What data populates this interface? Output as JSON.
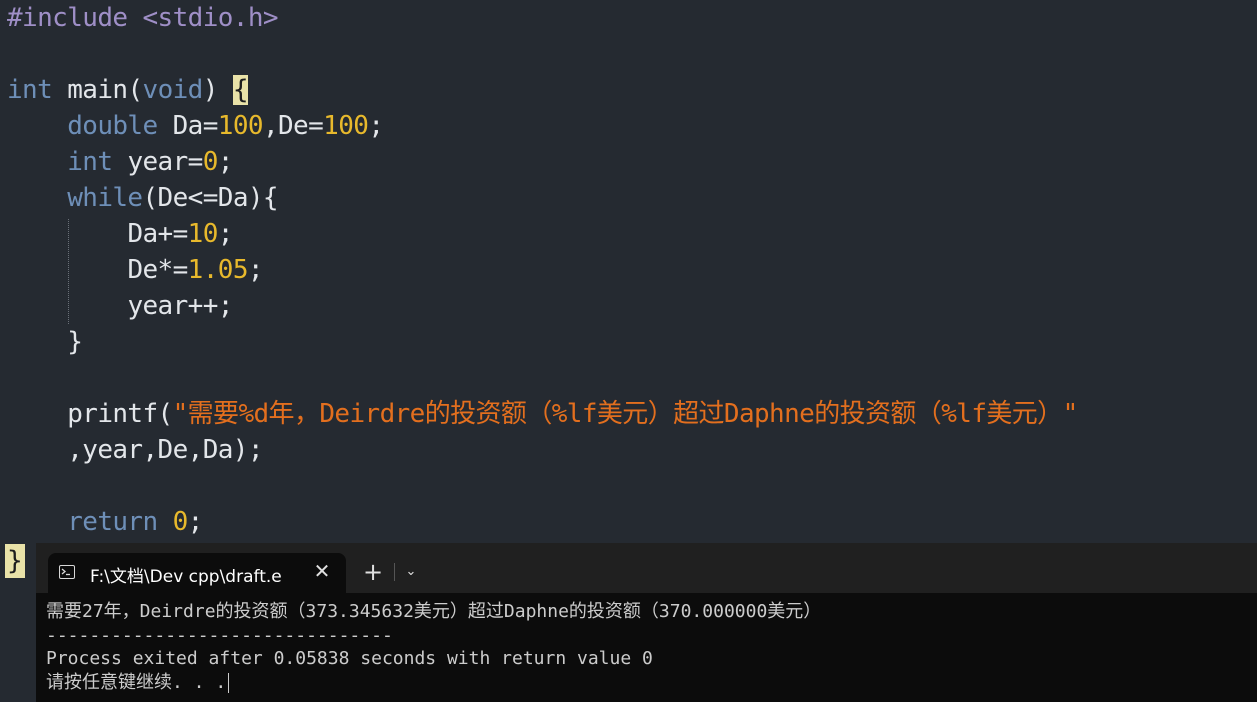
{
  "editor": {
    "lines": [
      [
        {
          "t": "#include <stdio.h>",
          "c": "pre"
        }
      ],
      [],
      [
        {
          "t": "int",
          "c": "kw"
        },
        {
          "t": " main",
          "c": "id"
        },
        {
          "t": "(",
          "c": "op"
        },
        {
          "t": "void",
          "c": "kw"
        },
        {
          "t": ") ",
          "c": "op"
        },
        {
          "t": "{",
          "c": "brace-hl"
        }
      ],
      [
        {
          "t": "    "
        },
        {
          "t": "double",
          "c": "kw"
        },
        {
          "t": " Da=",
          "c": "id"
        },
        {
          "t": "100",
          "c": "num"
        },
        {
          "t": ",De=",
          "c": "id"
        },
        {
          "t": "100",
          "c": "num"
        },
        {
          "t": ";",
          "c": "op"
        }
      ],
      [
        {
          "t": "    "
        },
        {
          "t": "int",
          "c": "kw"
        },
        {
          "t": " year=",
          "c": "id"
        },
        {
          "t": "0",
          "c": "num"
        },
        {
          "t": ";",
          "c": "op"
        }
      ],
      [
        {
          "t": "    "
        },
        {
          "t": "while",
          "c": "kw"
        },
        {
          "t": "(De<=Da){",
          "c": "id"
        }
      ],
      [
        {
          "t": "        "
        },
        {
          "t": "Da+=",
          "c": "id"
        },
        {
          "t": "10",
          "c": "num"
        },
        {
          "t": ";",
          "c": "op"
        }
      ],
      [
        {
          "t": "        "
        },
        {
          "t": "De*=",
          "c": "id"
        },
        {
          "t": "1.05",
          "c": "num"
        },
        {
          "t": ";",
          "c": "op"
        }
      ],
      [
        {
          "t": "        "
        },
        {
          "t": "year++;",
          "c": "id"
        }
      ],
      [
        {
          "t": "    "
        },
        {
          "t": "}",
          "c": "op"
        }
      ],
      [],
      [
        {
          "t": "    "
        },
        {
          "t": "printf(",
          "c": "id"
        },
        {
          "t": "\"需要%d年，Deirdre的投资额（%lf美元）超过Daphne的投资额（%lf美元）\"",
          "c": "str"
        }
      ],
      [
        {
          "t": "    "
        },
        {
          "t": ",year,De,Da);",
          "c": "id"
        }
      ],
      [],
      [
        {
          "t": "    "
        },
        {
          "t": "return",
          "c": "kw"
        },
        {
          "t": " ",
          "c": "id"
        },
        {
          "t": "0",
          "c": "num"
        },
        {
          "t": ";",
          "c": "op"
        }
      ]
    ],
    "closing_brace": "}"
  },
  "terminal": {
    "tab_title": "F:\\文档\\Dev cpp\\draft.e",
    "close_glyph": "✕",
    "new_tab_glyph": "+",
    "dropdown_glyph": "⌄",
    "output": [
      "需要27年，Deirdre的投资额（373.345632美元）超过Daphne的投资额（370.000000美元）",
      "--------------------------------",
      "Process exited after 0.05838 seconds with return value 0",
      "请按任意键继续. . ."
    ]
  },
  "colors": {
    "editor_bg": "#252a31",
    "keyword": "#6e8fb8",
    "number": "#e8b92c",
    "string": "#e36f1e",
    "preprocessor": "#9f8fc7",
    "terminal_bg": "#0c0c0c"
  }
}
